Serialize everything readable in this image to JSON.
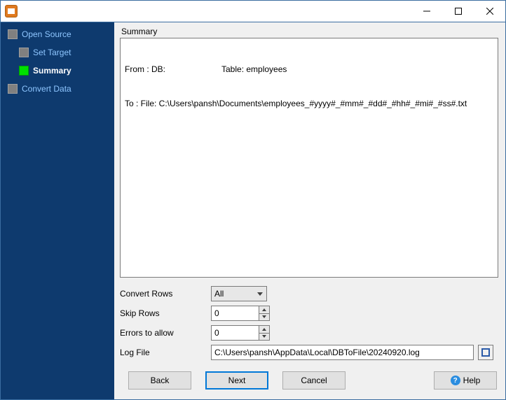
{
  "window": {
    "title": ""
  },
  "sidebar": {
    "steps": [
      {
        "label": "Open Source",
        "active": false
      },
      {
        "label": "Set Target",
        "active": false
      },
      {
        "label": "Summary",
        "active": true
      },
      {
        "label": "Convert Data",
        "active": false
      }
    ]
  },
  "main": {
    "section_title": "Summary",
    "summary": {
      "from_label": "From : DB:",
      "from_table": "Table: employees",
      "to_line": "To : File: C:\\Users\\pansh\\Documents\\employees_#yyyy#_#mm#_#dd#_#hh#_#mi#_#ss#.txt"
    },
    "form": {
      "convert_rows_label": "Convert Rows",
      "convert_rows_value": "All",
      "skip_rows_label": "Skip Rows",
      "skip_rows_value": "0",
      "errors_allow_label": "Errors to allow",
      "errors_allow_value": "0",
      "log_file_label": "Log File",
      "log_file_value": "C:\\Users\\pansh\\AppData\\Local\\DBToFile\\20240920.log"
    }
  },
  "buttons": {
    "back": "Back",
    "next": "Next",
    "cancel": "Cancel",
    "help": "Help"
  }
}
